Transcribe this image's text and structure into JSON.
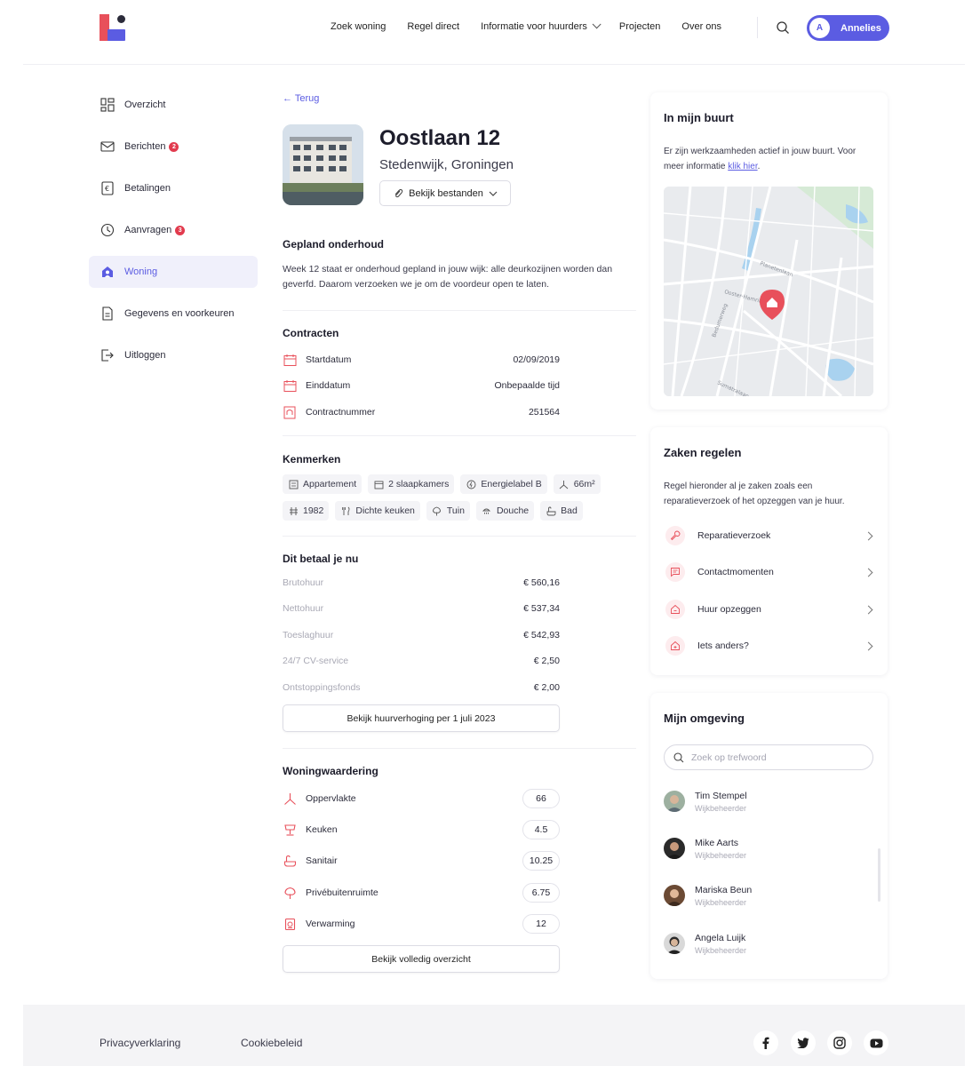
{
  "header": {
    "nav": [
      {
        "label": "Zoek woning"
      },
      {
        "label": "Regel direct"
      },
      {
        "label": "Informatie voor huurders",
        "has_dropdown": true
      },
      {
        "label": "Projecten"
      },
      {
        "label": "Over ons"
      }
    ],
    "user": {
      "initial": "A",
      "name": "Annelies"
    }
  },
  "sidebar": {
    "items": [
      {
        "label": "Overzicht",
        "icon": "dashboard-icon"
      },
      {
        "label": "Berichten",
        "icon": "mail-icon",
        "badge": "2"
      },
      {
        "label": "Betalingen",
        "icon": "payment-icon"
      },
      {
        "label": "Aanvragen",
        "icon": "clock-icon",
        "badge": "3"
      },
      {
        "label": "Woning",
        "icon": "home-icon",
        "active": true
      },
      {
        "label": "Gegevens en voorkeuren",
        "icon": "document-icon"
      },
      {
        "label": "Uitloggen",
        "icon": "logout-icon"
      }
    ]
  },
  "main": {
    "back": "← Terug",
    "title": "Oostlaan 12",
    "subtitle": "Stedenwijk, Groningen",
    "files_button": "Bekijk bestanden",
    "maintenance": {
      "title": "Gepland onderhoud",
      "text": "Week 12 staat er onderhoud gepland in jouw wijk: alle deurkozijnen worden dan geverfd. Daarom verzoeken we je om de voordeur open te laten."
    },
    "contracts": {
      "title": "Contracten",
      "rows": [
        {
          "label": "Startdatum",
          "value": "02/09/2019",
          "icon": "calendar-icon"
        },
        {
          "label": "Einddatum",
          "value": "Onbepaalde tijd",
          "icon": "calendar-icon"
        },
        {
          "label": "Contractnummer",
          "value": "251564",
          "icon": "contract-icon"
        }
      ]
    },
    "features": {
      "title": "Kenmerken",
      "chips": [
        {
          "label": "Appartement",
          "icon": "building-icon"
        },
        {
          "label": "2 slaapkamers",
          "icon": "bed-icon"
        },
        {
          "label": "Energielabel B",
          "icon": "energy-icon"
        },
        {
          "label": "66m²",
          "icon": "area-icon"
        },
        {
          "label": "1982",
          "icon": "year-icon"
        },
        {
          "label": "Dichte keuken",
          "icon": "kitchen-icon"
        },
        {
          "label": "Tuin",
          "icon": "tree-icon"
        },
        {
          "label": "Douche",
          "icon": "shower-icon"
        },
        {
          "label": "Bad",
          "icon": "bath-icon"
        }
      ]
    },
    "payment": {
      "title": "Dit betaal je nu",
      "rows": [
        {
          "label": "Brutohuur",
          "value": "€ 560,16"
        },
        {
          "label": "Nettohuur",
          "value": "€ 537,34"
        },
        {
          "label": "Toeslaghuur",
          "value": "€ 542,93"
        },
        {
          "label": "24/7 CV-service",
          "value": "€ 2,50"
        },
        {
          "label": "Ontstoppingsfonds",
          "value": "€ 2,00"
        }
      ],
      "button": "Bekijk huurverhoging per 1 juli 2023"
    },
    "valuation": {
      "title": "Woningwaardering",
      "rows": [
        {
          "label": "Oppervlakte",
          "value": "66",
          "icon": "area-icon"
        },
        {
          "label": "Keuken",
          "value": "4.5",
          "icon": "kitchen-icon"
        },
        {
          "label": "Sanitair",
          "value": "10.25",
          "icon": "bath-icon"
        },
        {
          "label": "Privébuitenruimte",
          "value": "6.75",
          "icon": "tree-icon"
        },
        {
          "label": "Verwarming",
          "value": "12",
          "icon": "heater-icon"
        }
      ],
      "button": "Bekijk volledig overzicht"
    }
  },
  "neighbourhood": {
    "title": "In mijn buurt",
    "text": "Er zijn werkzaamheden actief in jouw buurt. Voor meer informatie",
    "link": "klik hier",
    "text_end": ".",
    "streets": [
      "Bedumerweg",
      "Planetenlaan",
      "Ooster-Hamriklaan",
      "Sumatralaan"
    ]
  },
  "tasks": {
    "title": "Zaken regelen",
    "text": "Regel hieronder al je zaken zoals een reparatieverzoek of het opzeggen van je huur.",
    "items": [
      {
        "label": "Reparatieverzoek",
        "icon": "wrench-icon"
      },
      {
        "label": "Contactmomenten",
        "icon": "message-icon"
      },
      {
        "label": "Huur opzeggen",
        "icon": "home-cancel-icon"
      },
      {
        "label": "Iets anders?",
        "icon": "home-plus-icon"
      }
    ]
  },
  "environment": {
    "title": "Mijn omgeving",
    "search_placeholder": "Zoek op trefwoord",
    "people": [
      {
        "name": "Tim Stempel",
        "role": "Wijkbeheerder"
      },
      {
        "name": "Mike Aarts",
        "role": "Wijkbeheerder"
      },
      {
        "name": "Mariska Beun",
        "role": "Wijkbeheerder"
      },
      {
        "name": "Angela Luijk",
        "role": "Wijkbeheerder"
      }
    ]
  },
  "footer": {
    "links": [
      "Privacyverklaring",
      "Cookiebeleid"
    ],
    "social": [
      "facebook-icon",
      "twitter-icon",
      "instagram-icon",
      "youtube-icon"
    ]
  },
  "colors": {
    "accent": "#5b5ce2",
    "brand_red": "#e8505b",
    "badge": "#e23b4e"
  }
}
